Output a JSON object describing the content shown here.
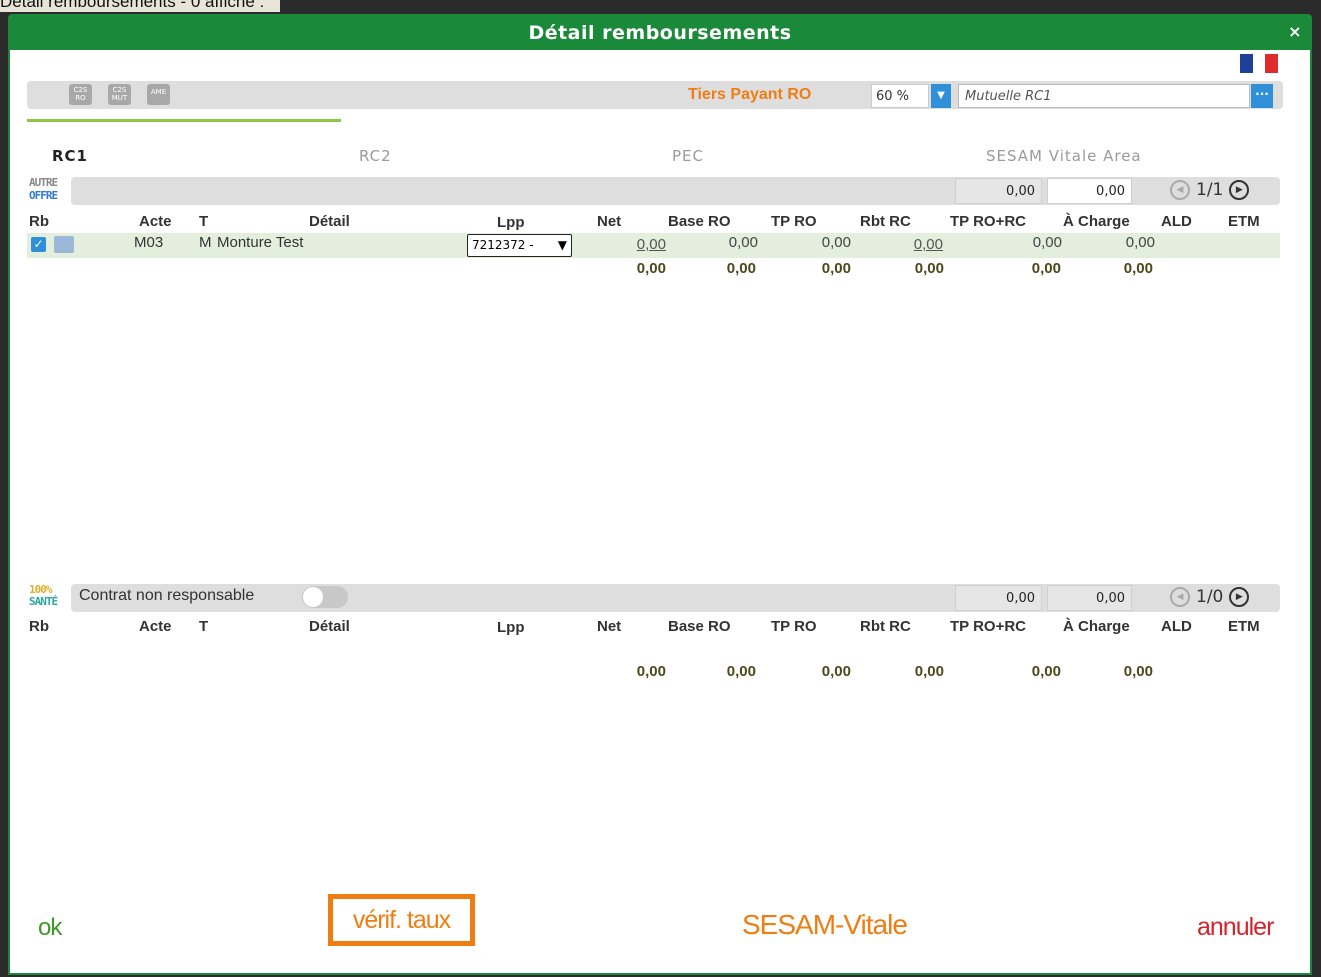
{
  "background_caption": "Détail remboursements - 0 affiché :",
  "dialog": {
    "title": "Détail remboursements",
    "close_icon": "×"
  },
  "topbar": {
    "chips": [
      {
        "l1": "C2S",
        "l2": "RO"
      },
      {
        "l1": "C2S",
        "l2": "MUT"
      },
      {
        "l1": "",
        "l2": "AME"
      }
    ],
    "tiers_payant_label": "Tiers Payant RO",
    "percent": "60 %",
    "mutuelle": "Mutuelle RC1",
    "more_icon": "···"
  },
  "tabs": [
    "RC1",
    "RC2",
    "PEC",
    "SESAM Vitale Area"
  ],
  "logos": {
    "offre_line1": "AUTRE",
    "offre_line2": "OFFRE",
    "sante_line1": "100%",
    "sante_line2": "SANTÉ"
  },
  "section1": {
    "amount_left": "0,00",
    "amount_right": "0,00",
    "pager": "1/1",
    "headers": {
      "rb": "Rb",
      "acte": "Acte",
      "t": "T",
      "detail": "Détail",
      "lpp": "Lpp",
      "net": "Net",
      "base_ro": "Base RO",
      "tp_ro": "TP RO",
      "rbt_rc": "Rbt RC",
      "tp_ro_rc": "TP RO+RC",
      "a_charge": "À Charge",
      "ald": "ALD",
      "etm": "ETM"
    },
    "row": {
      "acte": "M03",
      "t": "M",
      "detail": "Monture Test",
      "lpp": "7212372 -",
      "net": "0,00",
      "base_ro": "0,00",
      "tp_ro": "0,00",
      "rbt_rc": "0,00",
      "tp_ro_rc": "0,00",
      "a_charge": "0,00"
    },
    "totals": {
      "net": "0,00",
      "base_ro": "0,00",
      "tp_ro": "0,00",
      "rbt_rc": "0,00",
      "tp_ro_rc": "0,00",
      "a_charge": "0,00"
    }
  },
  "section2": {
    "contrat_label": "Contrat non responsable",
    "amount_left": "0,00",
    "amount_right": "0,00",
    "pager": "1/0",
    "totals": {
      "net": "0,00",
      "base_ro": "0,00",
      "tp_ro": "0,00",
      "rbt_rc": "0,00",
      "tp_ro_rc": "0,00",
      "a_charge": "0,00"
    }
  },
  "footer": {
    "ok": "ok",
    "verif": "vérif. taux",
    "sesam": "SESAM-Vitale",
    "annuler": "annuler"
  },
  "colors": {
    "title_green": "#1a8a3a",
    "accent_orange": "#f07d12",
    "cancel_red": "#d6232a",
    "ok_green": "#3c9a2c"
  }
}
